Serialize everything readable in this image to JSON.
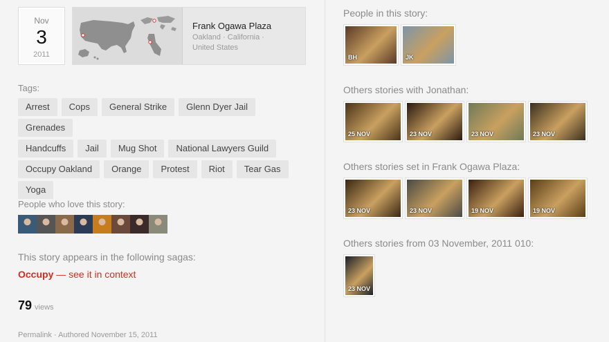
{
  "date": {
    "month": "Nov",
    "day": "3",
    "year": "2011"
  },
  "place": {
    "name": "Frank Ogawa Plaza",
    "city": "Oakland",
    "region": "California",
    "country": "United States",
    "separator": " ·"
  },
  "tags_label": "Tags:",
  "tags": [
    [
      "Arrest",
      "Cops",
      "General Strike",
      "Glenn Dyer Jail",
      "Grenades"
    ],
    [
      "Handcuffs",
      "Jail",
      "Mug Shot",
      "National Lawyers Guild"
    ],
    [
      "Occupy Oakland",
      "Orange",
      "Protest",
      "Riot",
      "Tear Gas"
    ],
    [
      "Yoga"
    ]
  ],
  "lovers_label": "People who love this story:",
  "lovers": [
    {
      "color": "#3a5a7a"
    },
    {
      "color": "#555"
    },
    {
      "color": "#8a6a4a"
    },
    {
      "color": "#2d3c56"
    },
    {
      "color": "#c77d1e"
    },
    {
      "color": "#6a4a3a"
    },
    {
      "color": "#3a2a2a"
    },
    {
      "color": "#8a8a7a"
    }
  ],
  "sagas_label": "This story appears in the following sagas:",
  "saga": {
    "name": "Occupy",
    "dash": " — ",
    "link": "see it in context"
  },
  "views": {
    "count": "79",
    "label": "views"
  },
  "footer": {
    "permalink": "Permalink",
    "sep": " · ",
    "authored": "Authored November 15, 2011"
  },
  "people_label": "People in this story:",
  "people": [
    {
      "caption": "BH",
      "color": "#5a3a28"
    },
    {
      "caption": "JK",
      "color": "#7c95a8"
    }
  ],
  "jonathan_label": "Others stories with Jonathan:",
  "jonathan": [
    {
      "caption": "25 NOV",
      "color": "#4a3418"
    },
    {
      "caption": "23 NOV",
      "color": "#2a1a10"
    },
    {
      "caption": "23 NOV",
      "color": "#6f7a58"
    },
    {
      "caption": "23 NOV",
      "color": "#3c3020"
    }
  ],
  "place_label": "Others stories set in Frank Ogawa Plaza:",
  "plaza": [
    {
      "caption": "23 NOV",
      "color": "#3a2814"
    },
    {
      "caption": "23 NOV",
      "color": "#4a4a44"
    },
    {
      "caption": "19 NOV",
      "color": "#3a2010"
    },
    {
      "caption": "19 NOV",
      "color": "#5a3e18"
    }
  ],
  "date_label": "Others stories from 03 November, 2011 010:",
  "sameday": [
    {
      "caption": "23 NOV",
      "color": "#1a2028"
    }
  ]
}
